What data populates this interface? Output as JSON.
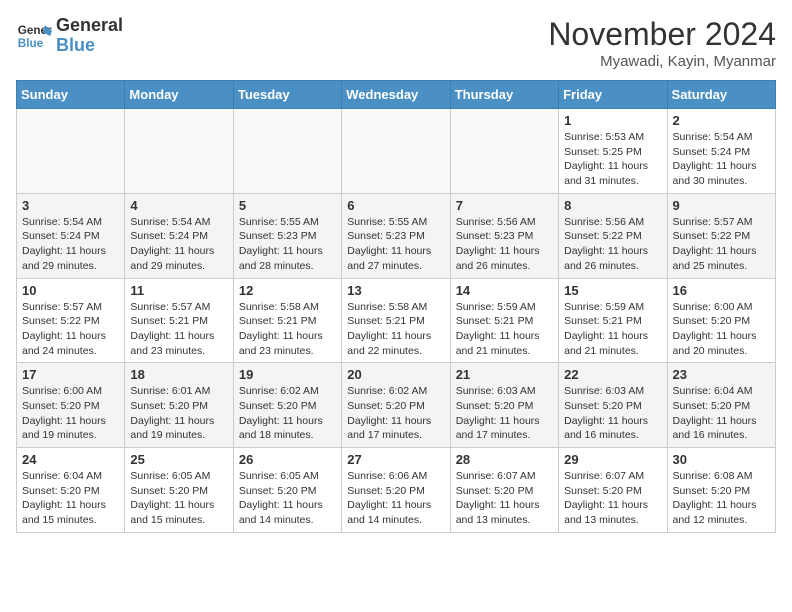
{
  "header": {
    "logo_line1": "General",
    "logo_line2": "Blue",
    "month": "November 2024",
    "location": "Myawadi, Kayin, Myanmar"
  },
  "weekdays": [
    "Sunday",
    "Monday",
    "Tuesday",
    "Wednesday",
    "Thursday",
    "Friday",
    "Saturday"
  ],
  "weeks": [
    [
      {
        "day": "",
        "info": ""
      },
      {
        "day": "",
        "info": ""
      },
      {
        "day": "",
        "info": ""
      },
      {
        "day": "",
        "info": ""
      },
      {
        "day": "",
        "info": ""
      },
      {
        "day": "1",
        "info": "Sunrise: 5:53 AM\nSunset: 5:25 PM\nDaylight: 11 hours\nand 31 minutes."
      },
      {
        "day": "2",
        "info": "Sunrise: 5:54 AM\nSunset: 5:24 PM\nDaylight: 11 hours\nand 30 minutes."
      }
    ],
    [
      {
        "day": "3",
        "info": "Sunrise: 5:54 AM\nSunset: 5:24 PM\nDaylight: 11 hours\nand 29 minutes."
      },
      {
        "day": "4",
        "info": "Sunrise: 5:54 AM\nSunset: 5:24 PM\nDaylight: 11 hours\nand 29 minutes."
      },
      {
        "day": "5",
        "info": "Sunrise: 5:55 AM\nSunset: 5:23 PM\nDaylight: 11 hours\nand 28 minutes."
      },
      {
        "day": "6",
        "info": "Sunrise: 5:55 AM\nSunset: 5:23 PM\nDaylight: 11 hours\nand 27 minutes."
      },
      {
        "day": "7",
        "info": "Sunrise: 5:56 AM\nSunset: 5:23 PM\nDaylight: 11 hours\nand 26 minutes."
      },
      {
        "day": "8",
        "info": "Sunrise: 5:56 AM\nSunset: 5:22 PM\nDaylight: 11 hours\nand 26 minutes."
      },
      {
        "day": "9",
        "info": "Sunrise: 5:57 AM\nSunset: 5:22 PM\nDaylight: 11 hours\nand 25 minutes."
      }
    ],
    [
      {
        "day": "10",
        "info": "Sunrise: 5:57 AM\nSunset: 5:22 PM\nDaylight: 11 hours\nand 24 minutes."
      },
      {
        "day": "11",
        "info": "Sunrise: 5:57 AM\nSunset: 5:21 PM\nDaylight: 11 hours\nand 23 minutes."
      },
      {
        "day": "12",
        "info": "Sunrise: 5:58 AM\nSunset: 5:21 PM\nDaylight: 11 hours\nand 23 minutes."
      },
      {
        "day": "13",
        "info": "Sunrise: 5:58 AM\nSunset: 5:21 PM\nDaylight: 11 hours\nand 22 minutes."
      },
      {
        "day": "14",
        "info": "Sunrise: 5:59 AM\nSunset: 5:21 PM\nDaylight: 11 hours\nand 21 minutes."
      },
      {
        "day": "15",
        "info": "Sunrise: 5:59 AM\nSunset: 5:21 PM\nDaylight: 11 hours\nand 21 minutes."
      },
      {
        "day": "16",
        "info": "Sunrise: 6:00 AM\nSunset: 5:20 PM\nDaylight: 11 hours\nand 20 minutes."
      }
    ],
    [
      {
        "day": "17",
        "info": "Sunrise: 6:00 AM\nSunset: 5:20 PM\nDaylight: 11 hours\nand 19 minutes."
      },
      {
        "day": "18",
        "info": "Sunrise: 6:01 AM\nSunset: 5:20 PM\nDaylight: 11 hours\nand 19 minutes."
      },
      {
        "day": "19",
        "info": "Sunrise: 6:02 AM\nSunset: 5:20 PM\nDaylight: 11 hours\nand 18 minutes."
      },
      {
        "day": "20",
        "info": "Sunrise: 6:02 AM\nSunset: 5:20 PM\nDaylight: 11 hours\nand 17 minutes."
      },
      {
        "day": "21",
        "info": "Sunrise: 6:03 AM\nSunset: 5:20 PM\nDaylight: 11 hours\nand 17 minutes."
      },
      {
        "day": "22",
        "info": "Sunrise: 6:03 AM\nSunset: 5:20 PM\nDaylight: 11 hours\nand 16 minutes."
      },
      {
        "day": "23",
        "info": "Sunrise: 6:04 AM\nSunset: 5:20 PM\nDaylight: 11 hours\nand 16 minutes."
      }
    ],
    [
      {
        "day": "24",
        "info": "Sunrise: 6:04 AM\nSunset: 5:20 PM\nDaylight: 11 hours\nand 15 minutes."
      },
      {
        "day": "25",
        "info": "Sunrise: 6:05 AM\nSunset: 5:20 PM\nDaylight: 11 hours\nand 15 minutes."
      },
      {
        "day": "26",
        "info": "Sunrise: 6:05 AM\nSunset: 5:20 PM\nDaylight: 11 hours\nand 14 minutes."
      },
      {
        "day": "27",
        "info": "Sunrise: 6:06 AM\nSunset: 5:20 PM\nDaylight: 11 hours\nand 14 minutes."
      },
      {
        "day": "28",
        "info": "Sunrise: 6:07 AM\nSunset: 5:20 PM\nDaylight: 11 hours\nand 13 minutes."
      },
      {
        "day": "29",
        "info": "Sunrise: 6:07 AM\nSunset: 5:20 PM\nDaylight: 11 hours\nand 13 minutes."
      },
      {
        "day": "30",
        "info": "Sunrise: 6:08 AM\nSunset: 5:20 PM\nDaylight: 11 hours\nand 12 minutes."
      }
    ]
  ]
}
